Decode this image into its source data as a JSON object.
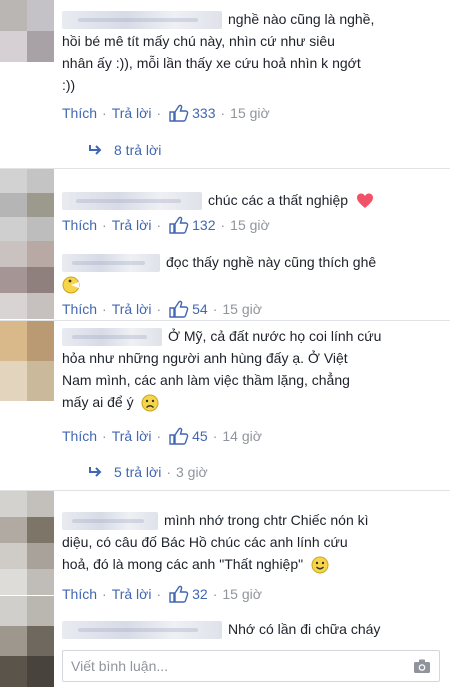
{
  "comments": [
    {
      "text_lines": [
        "nghề nào cũng là nghề,",
        "hồi bé mê tít mấy chú này, nhìn cứ như siêu",
        "nhân ấy :)), mỗi lần thấy xe cứu hoả nhìn k ngớt",
        ":))"
      ],
      "like_label": "Thích",
      "reply_label": "Trả lời",
      "likes": "333",
      "time": "15 giờ",
      "replies": "8 trả lời"
    },
    {
      "text_lines": [
        "chúc các a thất nghiệp"
      ],
      "emoji": "heart-icon",
      "like_label": "Thích",
      "reply_label": "Trả lời",
      "likes": "132",
      "time": "15 giờ"
    },
    {
      "text_lines": [
        "đọc thấy nghề này cũng thích ghê"
      ],
      "emoji": "pacman-smiley-icon",
      "like_label": "Thích",
      "reply_label": "Trả lời",
      "likes": "54",
      "time": "15 giờ"
    },
    {
      "text_lines": [
        "Ở Mỹ, cả đất nước họ coi lính cứu",
        "hỏa như những người anh hùng đấy ạ. Ở Việt",
        "Nam mình, các anh làm việc thầm lặng, chẳng",
        "mấy ai để ý"
      ],
      "emoji": "frown-icon",
      "like_label": "Thích",
      "reply_label": "Trả lời",
      "likes": "45",
      "time": "14 giờ",
      "replies": "5 trả lời",
      "replies_time": "3 giờ"
    },
    {
      "text_lines": [
        "mình nhớ trong chtr Chiếc nón kì",
        "diệu, có câu đố Bác Hồ chúc các anh lính cứu",
        "hoả, đó là mong các anh \"Thất nghiệp\""
      ],
      "emoji": "smile-icon",
      "like_label": "Thích",
      "reply_label": "Trả lời",
      "likes": "32",
      "time": "15 giờ"
    },
    {
      "text_lines": [
        "Nhớ có lần đi chữa cháy"
      ]
    }
  ],
  "composer": {
    "placeholder": "Viết bình luận..."
  },
  "colors": {
    "link": "#4267b2",
    "meta": "#90949c",
    "text": "#1d2129",
    "divider": "#e1e2e5",
    "heart": "#f25268",
    "emoji_yellow": "#f7d54a"
  }
}
